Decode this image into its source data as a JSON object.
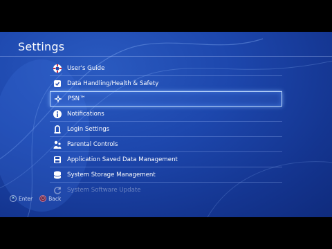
{
  "header": {
    "title": "Settings"
  },
  "menu": {
    "items": [
      {
        "label": "User's Guide",
        "icon": "lifebuoy-icon"
      },
      {
        "label": "Data Handling/Health & Safety",
        "icon": "shield-check-icon"
      },
      {
        "label": "PSN™",
        "icon": "psn-icon",
        "selected": true
      },
      {
        "label": "Notifications",
        "icon": "info-icon"
      },
      {
        "label": "Login Settings",
        "icon": "login-icon"
      },
      {
        "label": "Parental Controls",
        "icon": "parental-icon"
      },
      {
        "label": "Application Saved Data Management",
        "icon": "saved-data-icon"
      },
      {
        "label": "System Storage Management",
        "icon": "storage-icon"
      },
      {
        "label": "System Software Update",
        "icon": "update-icon"
      }
    ]
  },
  "footer": {
    "enter_label": "Enter",
    "back_label": "Back"
  },
  "colors": {
    "background": "#1d47ad",
    "selection_border": "#c8e1ff"
  }
}
